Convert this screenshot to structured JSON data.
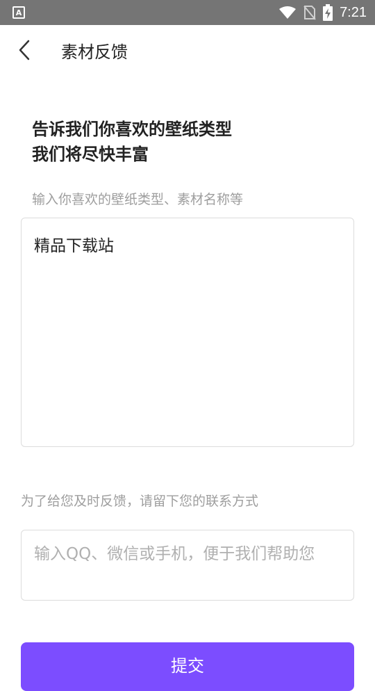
{
  "status_bar": {
    "time": "7:21",
    "left_icon": "A",
    "icons": [
      "wifi-icon",
      "no-sim-icon",
      "battery-charging-icon"
    ]
  },
  "app_bar": {
    "title": "素材反馈",
    "back_icon": "chevron-left-icon"
  },
  "form": {
    "heading_line1": "告诉我们你喜欢的壁纸类型",
    "heading_line2": "我们将尽快丰富",
    "type_hint": "输入你喜欢的壁纸类型、素材名称等",
    "type_value": "精品下载站",
    "contact_hint": "为了给您及时反馈，请留下您的联系方式",
    "contact_placeholder": "输入QQ、微信或手机，便于我们帮助您",
    "submit_label": "提交"
  },
  "colors": {
    "status_bar": "#757575",
    "accent": "#7c4dff",
    "hint_text": "#9e9e9e"
  }
}
